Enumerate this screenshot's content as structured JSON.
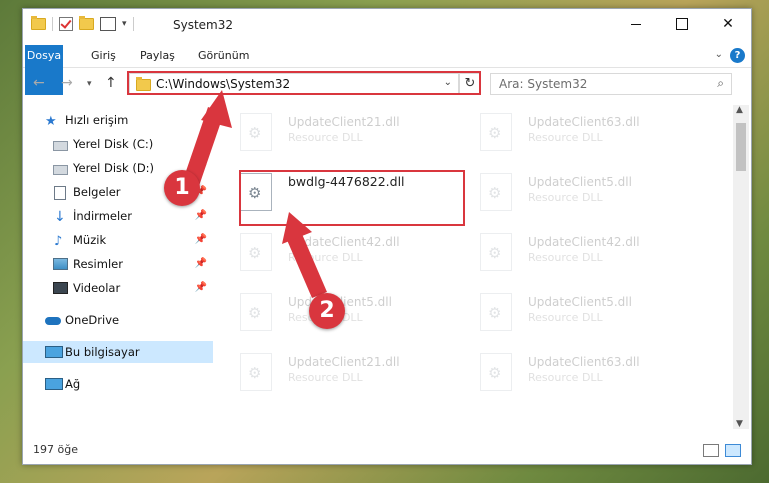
{
  "window": {
    "title": "System32"
  },
  "ribbon": {
    "tabs": [
      "Dosya",
      "Giriş",
      "Paylaş",
      "Görünüm"
    ]
  },
  "address": {
    "path": "C:\\Windows\\System32"
  },
  "search": {
    "placeholder": "Ara: System32"
  },
  "sidebar": {
    "quick_access": "Hızlı erişim",
    "items": [
      {
        "label": "Yerel Disk (C:)",
        "icon": "drive-icon",
        "pinned": true
      },
      {
        "label": "Yerel Disk (D:)",
        "icon": "drive-icon",
        "pinned": true
      },
      {
        "label": "Belgeler",
        "icon": "documents-icon",
        "pinned": true
      },
      {
        "label": "İndirmeler",
        "icon": "download-icon",
        "pinned": true
      },
      {
        "label": "Müzik",
        "icon": "music-icon",
        "pinned": true
      },
      {
        "label": "Resimler",
        "icon": "pictures-icon",
        "pinned": true
      },
      {
        "label": "Videolar",
        "icon": "videos-icon",
        "pinned": true
      }
    ],
    "onedrive": "OneDrive",
    "this_pc": "Bu bilgisayar",
    "network": "Ağ"
  },
  "files": {
    "highlighted": {
      "name": "bwdlg-4476822.dll"
    },
    "ghosts": [
      {
        "name": "UpdateClient21.dll",
        "type": "Resource DLL"
      },
      {
        "name": "UpdateClient63.dll",
        "type": "Resource DLL"
      },
      {
        "name": "UpdateClient5.dll",
        "type": "Resource DLL"
      },
      {
        "name": "UpdateClient42.dll",
        "type": "Resource DLL"
      },
      {
        "name": "UpdateClient42.dll",
        "type": "Resource DLL"
      },
      {
        "name": "UpdateClient5.dll",
        "type": "Resource DLL"
      },
      {
        "name": "UpdateClient5.dll",
        "type": "Resource DLL"
      },
      {
        "name": "UpdateClient21.dll",
        "type": "Resource DLL"
      },
      {
        "name": "UpdateClient63.dll",
        "type": "Resource DLL"
      }
    ]
  },
  "status": {
    "count": "197 öğe"
  },
  "annotations": {
    "step1": "1",
    "step2": "2",
    "color": "#d9363e"
  }
}
